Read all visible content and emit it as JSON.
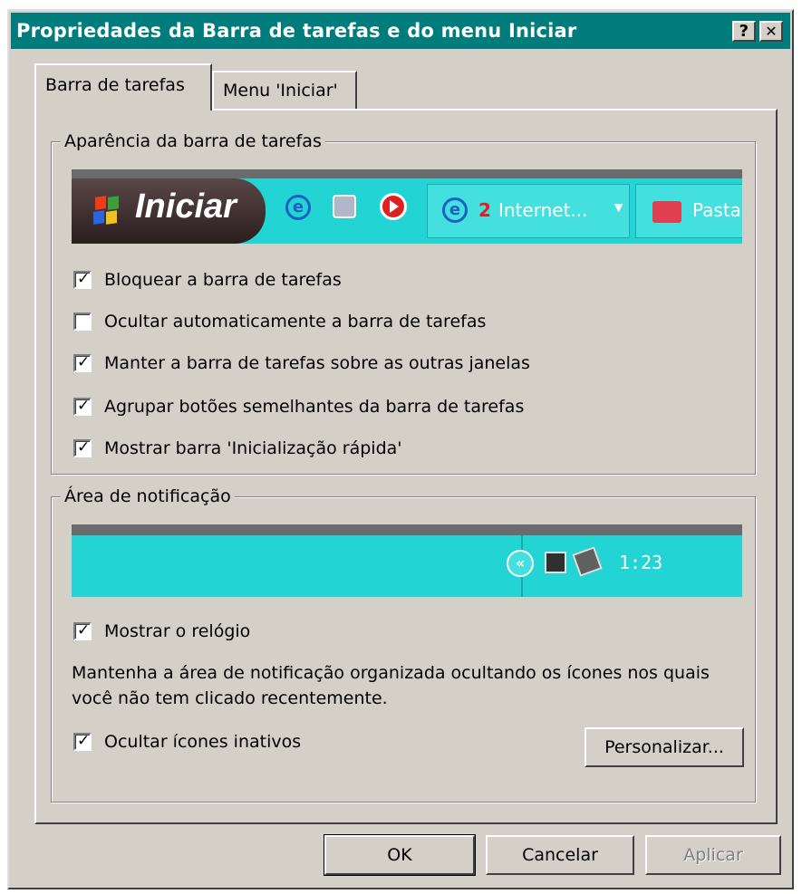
{
  "window": {
    "title": "Propriedades da Barra de tarefas e do menu Iniciar",
    "help_label": "?",
    "close_label": "✕"
  },
  "tabs": [
    {
      "label": "Barra de tarefas",
      "active": true
    },
    {
      "label": "Menu 'Iniciar'",
      "active": false
    }
  ],
  "appearance": {
    "group_label": "Aparência da barra de tarefas",
    "preview": {
      "start_label": "Iniciar",
      "task_count": "2",
      "task_label": "Internet...",
      "folder_label": "Pasta"
    },
    "options": [
      {
        "label": "Bloquear a barra de tarefas",
        "checked": true
      },
      {
        "label": "Ocultar automaticamente a barra de tarefas",
        "checked": false
      },
      {
        "label": "Manter a barra de tarefas sobre as outras janelas",
        "checked": true
      },
      {
        "label": "Agrupar botões semelhantes da barra de tarefas",
        "checked": true
      },
      {
        "label": "Mostrar barra 'Inicialização rápida'",
        "checked": true
      }
    ]
  },
  "notification": {
    "group_label": "Área de notificação",
    "clock_time": "1:23",
    "show_clock": {
      "label": "Mostrar o relógio",
      "checked": true
    },
    "description": "Mantenha a área de notificação organizada ocultando os ícones nos quais você não tem clicado recentemente.",
    "hide_inactive": {
      "label": "Ocultar ícones inativos",
      "checked": true
    },
    "customize_label": "Personalizar..."
  },
  "buttons": {
    "ok": "OK",
    "cancel": "Cancelar",
    "apply": "Aplicar"
  },
  "colors": {
    "titlebar": "#007c7c",
    "face": "#d4d0c8",
    "taskbar_teal": "#22d4d4",
    "start_dark": "#3a2a2a"
  }
}
